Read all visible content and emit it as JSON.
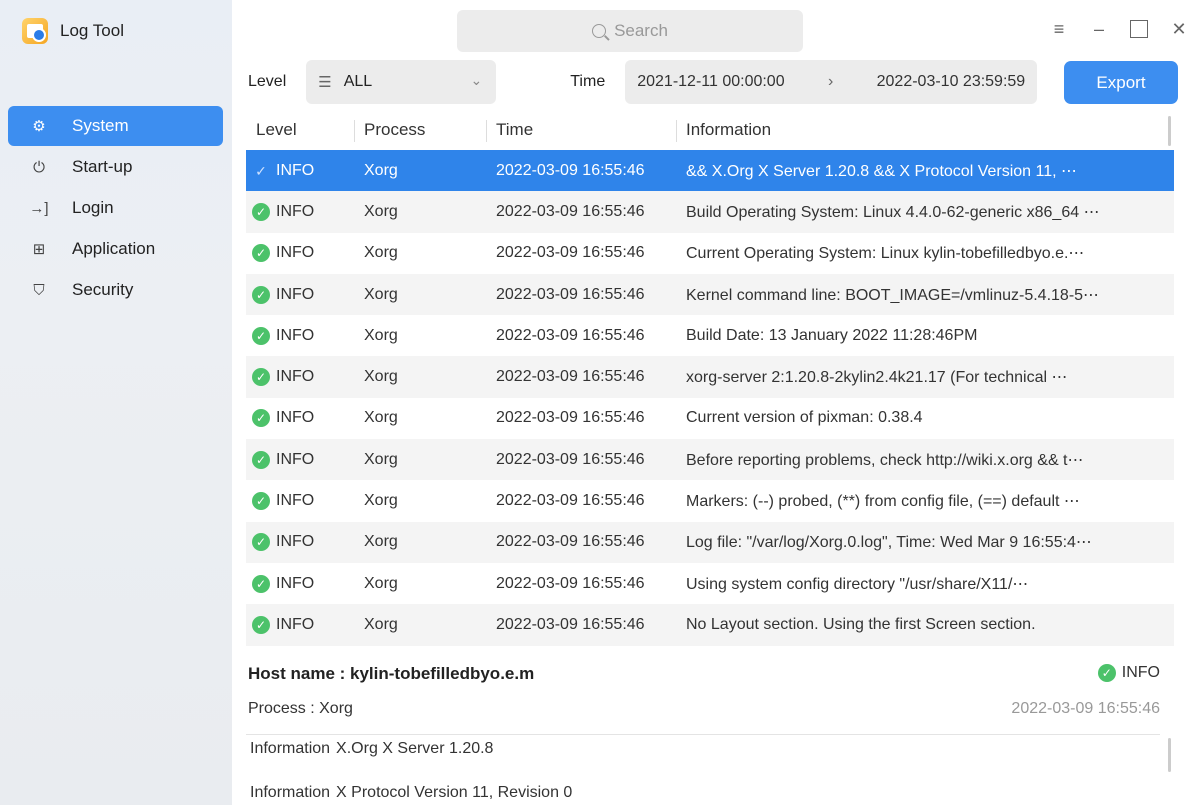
{
  "app": {
    "title": "Log Tool"
  },
  "sidebar": {
    "items": [
      {
        "label": "System",
        "icon": "gear-icon",
        "active": true
      },
      {
        "label": "Start-up",
        "icon": "power-icon"
      },
      {
        "label": "Login",
        "icon": "login-icon"
      },
      {
        "label": "Application",
        "icon": "apps-grid-icon"
      },
      {
        "label": "Security",
        "icon": "shield-icon"
      }
    ]
  },
  "search": {
    "placeholder": "Search"
  },
  "filters": {
    "level_label": "Level",
    "level_value": "ALL",
    "time_label": "Time",
    "time_from": "2021-12-11 00:00:00",
    "time_to": "2022-03-10 23:59:59",
    "export_label": "Export"
  },
  "table": {
    "headers": {
      "level": "Level",
      "process": "Process",
      "time": "Time",
      "info": "Information"
    },
    "rows": [
      {
        "level": "INFO",
        "process": "Xorg",
        "time": "2022-03-09 16:55:46",
        "info": "&& X.Org X Server 1.20.8 && X Protocol Version 11, ⋯"
      },
      {
        "level": "INFO",
        "process": "Xorg",
        "time": "2022-03-09 16:55:46",
        "info": "Build Operating System: Linux 4.4.0-62-generic x86_64 ⋯"
      },
      {
        "level": "INFO",
        "process": "Xorg",
        "time": "2022-03-09 16:55:46",
        "info": "Current Operating System: Linux kylin-tobefilledbyo.e.⋯"
      },
      {
        "level": "INFO",
        "process": "Xorg",
        "time": "2022-03-09 16:55:46",
        "info": "Kernel command line: BOOT_IMAGE=/vmlinuz-5.4.18-5⋯"
      },
      {
        "level": "INFO",
        "process": "Xorg",
        "time": "2022-03-09 16:55:46",
        "info": "Build Date: 13 January 2022  11:28:46PM"
      },
      {
        "level": "INFO",
        "process": "Xorg",
        "time": "2022-03-09 16:55:46",
        "info": "xorg-server 2:1.20.8-2kylin2.4k21.17 (For technical ⋯"
      },
      {
        "level": "INFO",
        "process": "Xorg",
        "time": "2022-03-09 16:55:46",
        "info": "Current version of pixman: 0.38.4"
      },
      {
        "level": "INFO",
        "process": "Xorg",
        "time": "2022-03-09 16:55:46",
        "info": "Before reporting problems, check http://wiki.x.org && t⋯"
      },
      {
        "level": "INFO",
        "process": "Xorg",
        "time": "2022-03-09 16:55:46",
        "info": "Markers: (--) probed, (**) from config file, (==) default ⋯"
      },
      {
        "level": "INFO",
        "process": "Xorg",
        "time": "2022-03-09 16:55:46",
        "info": "Log file: \"/var/log/Xorg.0.log\", Time: Wed Mar  9 16:55:4⋯"
      },
      {
        "level": "INFO",
        "process": "Xorg",
        "time": "2022-03-09 16:55:46",
        "info": "Using system config directory \"/usr/share/X11/⋯"
      },
      {
        "level": "INFO",
        "process": "Xorg",
        "time": "2022-03-09 16:55:46",
        "info": "No Layout section.  Using the first Screen section."
      }
    ]
  },
  "detail": {
    "host": "Host name : kylin-tobefilledbyo.e.m",
    "level": "INFO",
    "process": "Process : Xorg",
    "time": "2022-03-09 16:55:46",
    "info_key": "Information",
    "info_lines": [
      "X.Org X Server 1.20.8",
      "X Protocol Version 11, Revision 0"
    ]
  },
  "colors": {
    "accent": "#3d8ef0",
    "selected_row": "#2f84ea",
    "ok": "#4cc26a"
  }
}
